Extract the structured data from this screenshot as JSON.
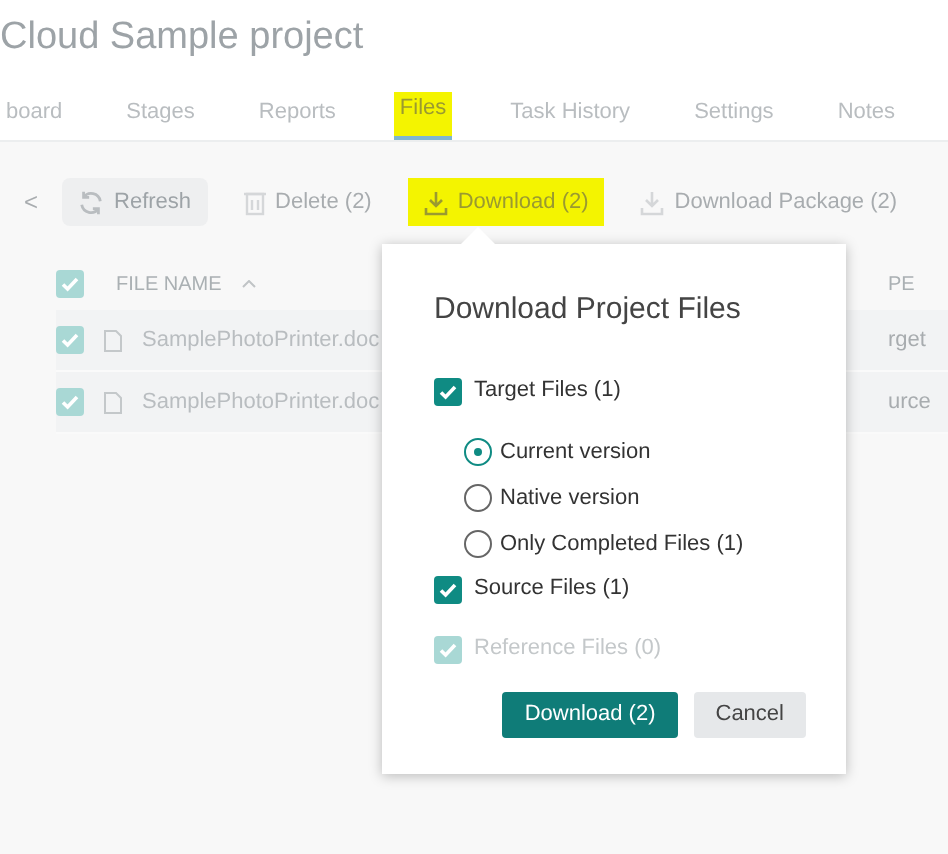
{
  "title": "Cloud Sample project",
  "tabs": [
    {
      "label": "board",
      "selected": false,
      "highlighted": false
    },
    {
      "label": "Stages",
      "selected": false,
      "highlighted": false
    },
    {
      "label": "Reports",
      "selected": false,
      "highlighted": false
    },
    {
      "label": "Files",
      "selected": true,
      "highlighted": true
    },
    {
      "label": "Task History",
      "selected": false,
      "highlighted": false
    },
    {
      "label": "Settings",
      "selected": false,
      "highlighted": false
    },
    {
      "label": "Notes",
      "selected": false,
      "highlighted": false
    }
  ],
  "toolbar": [
    {
      "kind": "back",
      "label": "<",
      "highlighted": false
    },
    {
      "kind": "refresh",
      "label": "Refresh",
      "highlighted": false
    },
    {
      "kind": "delete",
      "label": "Delete (2)",
      "highlighted": false
    },
    {
      "kind": "download",
      "label": "Download (2)",
      "highlighted": true
    },
    {
      "kind": "package",
      "label": "Download Package (2)",
      "highlighted": false
    },
    {
      "kind": "caret"
    }
  ],
  "table": {
    "header_checked": true,
    "columns": [
      "FILE NAME",
      "PE"
    ],
    "rows": [
      {
        "checked": true,
        "name": "SamplePhotoPrinter.doc",
        "column_2": "rget"
      },
      {
        "checked": true,
        "name": "SamplePhotoPrinter.doc",
        "column_2": "urce"
      }
    ]
  },
  "dialog": {
    "title": "Download Project Files",
    "options": [
      {
        "kind": "checkbox",
        "label": "Target Files (1)",
        "checked": true,
        "disabled": false
      },
      {
        "kind": "radio",
        "label": "Current version",
        "selected": true
      },
      {
        "kind": "radio",
        "label": "Native version",
        "selected": false
      },
      {
        "kind": "radio",
        "label": "Only Completed Files (1)",
        "selected": false
      },
      {
        "kind": "checkbox",
        "label": "Source Files (1)",
        "checked": true,
        "disabled": false
      },
      {
        "kind": "checkbox",
        "label": "Reference Files (0)",
        "checked": true,
        "disabled": true
      }
    ],
    "buttons": [
      {
        "kind": "primary",
        "label": "Download (2)"
      },
      {
        "kind": "secondary",
        "label": "Cancel"
      }
    ]
  }
}
